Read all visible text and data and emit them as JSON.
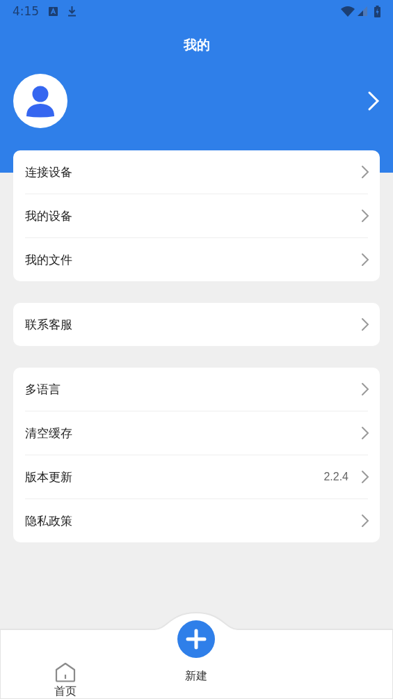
{
  "status_bar": {
    "time": "4:15"
  },
  "header": {
    "title": "我的"
  },
  "menu_groups": [
    {
      "items": [
        {
          "label": "连接设备"
        },
        {
          "label": "我的设备"
        },
        {
          "label": "我的文件"
        }
      ]
    },
    {
      "items": [
        {
          "label": "联系客服"
        }
      ]
    },
    {
      "items": [
        {
          "label": "多语言"
        },
        {
          "label": "清空缓存"
        },
        {
          "label": "版本更新",
          "value": "2.2.4"
        },
        {
          "label": "隐私政策"
        }
      ]
    }
  ],
  "bottom_nav": [
    {
      "label": "首页",
      "kind": "home"
    },
    {
      "label": "新建",
      "kind": "add"
    }
  ]
}
